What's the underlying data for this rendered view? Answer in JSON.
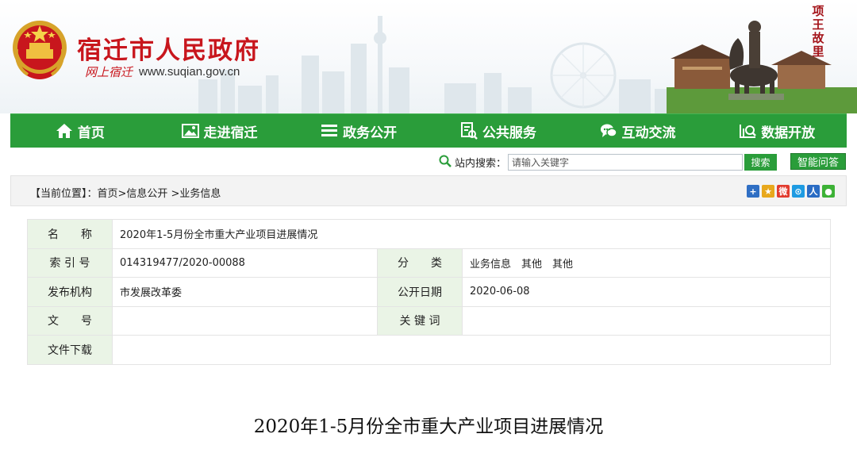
{
  "header": {
    "site_title": "宿迁市人民政府",
    "calligraphy": "网上宿迁",
    "url": "www.suqian.gov.cn",
    "poem": "项王故里"
  },
  "nav": {
    "items": [
      {
        "label": "首页",
        "icon": "home-icon"
      },
      {
        "label": "走进宿迁",
        "icon": "picture-icon"
      },
      {
        "label": "政务公开",
        "icon": "list-icon"
      },
      {
        "label": "公共服务",
        "icon": "document-search-icon"
      },
      {
        "label": "互动交流",
        "icon": "chat-icon"
      },
      {
        "label": "数据开放",
        "icon": "data-search-icon"
      }
    ],
    "color": "#2a9d3a"
  },
  "search": {
    "label": "站内搜索：",
    "placeholder": "请输入关键字",
    "button": "搜索",
    "qa_button": "智能问答"
  },
  "breadcrumb": {
    "prefix": "【当前位置】：",
    "path": "首页>信息公开 >业务信息"
  },
  "share_icons": [
    "plus-share-icon",
    "qzone-icon",
    "weibo-icon",
    "tencent-weibo-icon",
    "renren-icon",
    "wechat-icon"
  ],
  "info": {
    "name_label": "名　　称",
    "name_value": "2020年1-5月份全市重大产业项目进展情况",
    "index_label": "索 引 号",
    "index_value": "014319477/2020-00088",
    "category_label": "分　　类",
    "category_value": "业务信息　其他　其他",
    "org_label": "发布机构",
    "org_value": "市发展改革委",
    "date_label": "公开日期",
    "date_value": "2020-06-08",
    "docno_label": "文　　号",
    "docno_value": "",
    "keywords_label": "关 键 词",
    "keywords_value": "",
    "download_label": "文件下载",
    "download_value": ""
  },
  "article": {
    "title": "2020年1-5月份全市重大产业项目进展情况"
  }
}
